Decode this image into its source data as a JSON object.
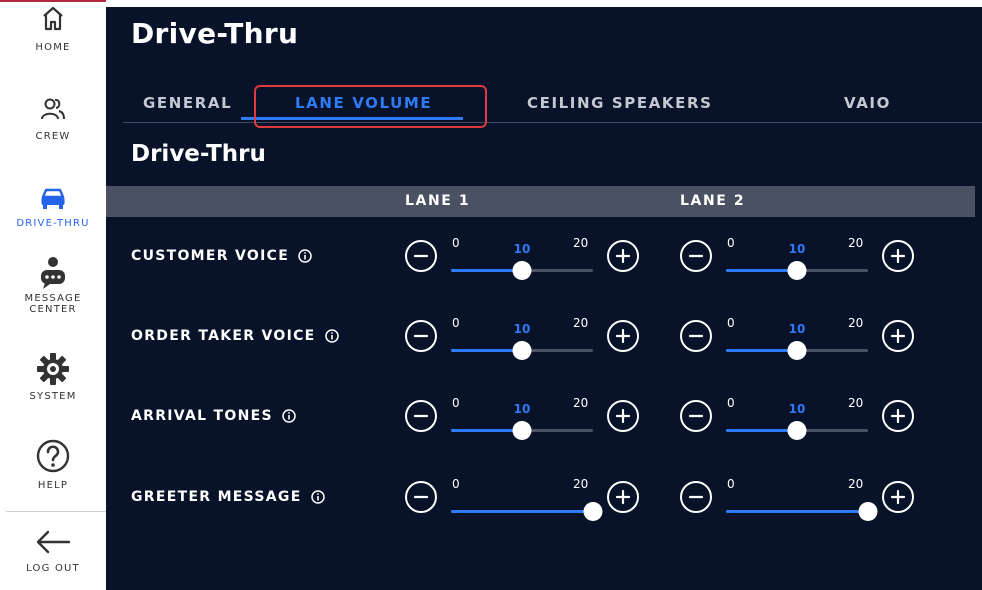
{
  "sidebar": {
    "items": [
      {
        "label": "HOME",
        "icon": "home-icon"
      },
      {
        "label": "CREW",
        "icon": "crew-icon"
      },
      {
        "label": "DRIVE-THRU",
        "icon": "car-icon",
        "active": true
      },
      {
        "label": "MESSAGE",
        "label2": "CENTER",
        "icon": "message-center-icon"
      },
      {
        "label": "SYSTEM",
        "icon": "gear-icon"
      },
      {
        "label": "HELP",
        "icon": "help-icon"
      },
      {
        "label": "LOG OUT",
        "icon": "arrow-left-icon"
      }
    ]
  },
  "header": {
    "title": "Drive-Thru"
  },
  "tabs": [
    {
      "label": "GENERAL"
    },
    {
      "label": "LANE VOLUME",
      "active": true
    },
    {
      "label": "CEILING SPEAKERS"
    },
    {
      "label": "VAIO"
    }
  ],
  "section": {
    "title": "Drive-Thru"
  },
  "lanes": [
    "LANE 1",
    "LANE 2"
  ],
  "rows": [
    {
      "label": "CUSTOMER VOICE",
      "lane1": {
        "min": "0",
        "max": "20",
        "value": "10",
        "fraction": 0.5
      },
      "lane2": {
        "min": "0",
        "max": "20",
        "value": "10",
        "fraction": 0.5
      }
    },
    {
      "label": "ORDER TAKER VOICE",
      "lane1": {
        "min": "0",
        "max": "20",
        "value": "10",
        "fraction": 0.5
      },
      "lane2": {
        "min": "0",
        "max": "20",
        "value": "10",
        "fraction": 0.5
      }
    },
    {
      "label": "ARRIVAL TONES",
      "lane1": {
        "min": "0",
        "max": "20",
        "value": "10",
        "fraction": 0.5
      },
      "lane2": {
        "min": "0",
        "max": "20",
        "value": "10",
        "fraction": 0.5
      }
    },
    {
      "label": "GREETER MESSAGE",
      "lane1": {
        "min": "0",
        "max": "20",
        "value": "",
        "fraction": 1.0
      },
      "lane2": {
        "min": "0",
        "max": "20",
        "value": "",
        "fraction": 1.0
      }
    }
  ],
  "colors": {
    "accent": "#2f7bf5",
    "panel": "#08132a",
    "highlight": "#e0393e"
  }
}
